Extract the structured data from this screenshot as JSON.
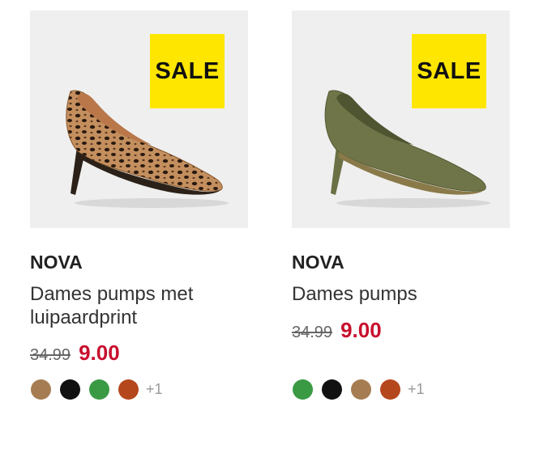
{
  "products": [
    {
      "badge": "SALE",
      "brand": "NOVA",
      "title": "Dames pumps met luipaardprint",
      "price_old": "34.99",
      "price_new": "9.00",
      "swatches": [
        "#a67c52",
        "#111111",
        "#3a9a44",
        "#b5471c"
      ],
      "more_colors": "+1"
    },
    {
      "badge": "SALE",
      "brand": "NOVA",
      "title": "Dames pumps",
      "price_old": "34.99",
      "price_new": "9.00",
      "swatches": [
        "#3a9a44",
        "#111111",
        "#a67c52",
        "#b5471c"
      ],
      "more_colors": "+1"
    }
  ]
}
